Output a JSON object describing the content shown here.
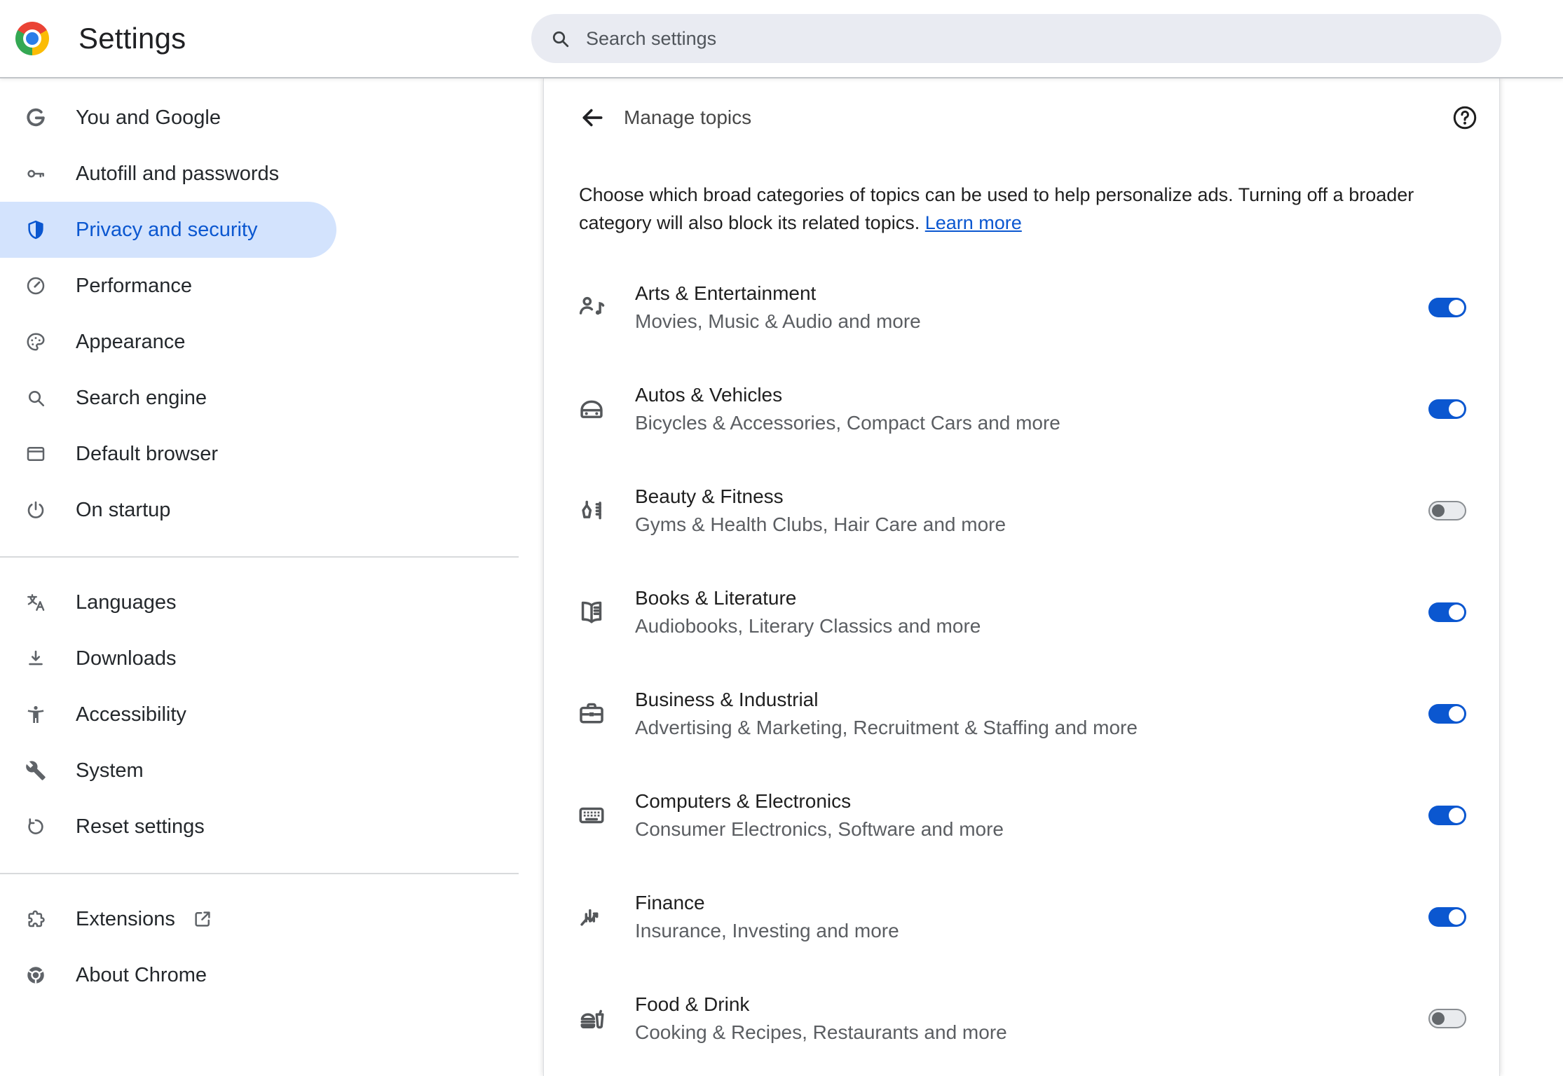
{
  "header": {
    "title": "Settings",
    "logo_icon": "chrome-logo-icon",
    "search_placeholder": "Search settings",
    "search_icon": "search-icon"
  },
  "sidebar": {
    "items": [
      {
        "label": "You and Google",
        "icon": "google-g-icon",
        "selected": false
      },
      {
        "label": "Autofill and passwords",
        "icon": "key-icon",
        "selected": false
      },
      {
        "label": "Privacy and security",
        "icon": "shield-icon",
        "selected": true
      },
      {
        "label": "Performance",
        "icon": "speedometer-icon",
        "selected": false
      },
      {
        "label": "Appearance",
        "icon": "palette-icon",
        "selected": false
      },
      {
        "label": "Search engine",
        "icon": "magnifier-icon",
        "selected": false
      },
      {
        "label": "Default browser",
        "icon": "browser-window-icon",
        "selected": false
      },
      {
        "label": "On startup",
        "icon": "power-icon",
        "selected": false,
        "divider_after": true
      },
      {
        "label": "Languages",
        "icon": "translate-icon",
        "selected": false
      },
      {
        "label": "Downloads",
        "icon": "download-icon",
        "selected": false
      },
      {
        "label": "Accessibility",
        "icon": "accessibility-icon",
        "selected": false
      },
      {
        "label": "System",
        "icon": "wrench-icon",
        "selected": false
      },
      {
        "label": "Reset settings",
        "icon": "reset-icon",
        "selected": false,
        "divider_after": true
      },
      {
        "label": "Extensions",
        "icon": "puzzle-icon",
        "selected": false,
        "external": true,
        "external_icon": "external-link-icon"
      },
      {
        "label": "About Chrome",
        "icon": "chrome-gray-icon",
        "selected": false
      }
    ]
  },
  "main": {
    "back_icon": "back-arrow-icon",
    "title": "Manage topics",
    "help_icon": "help-icon",
    "description": "Choose which broad categories of topics can be used to help personalize ads. Turning off a broader category will also block its related topics.",
    "learn_more_label": "Learn more",
    "topics": [
      {
        "name": "Arts & Entertainment",
        "examples": "Movies, Music & Audio and more",
        "icon": "arts-entertainment-icon",
        "enabled": true
      },
      {
        "name": "Autos & Vehicles",
        "examples": "Bicycles & Accessories, Compact Cars and more",
        "icon": "autos-vehicles-icon",
        "enabled": true
      },
      {
        "name": "Beauty & Fitness",
        "examples": "Gyms & Health Clubs, Hair Care and more",
        "icon": "beauty-fitness-icon",
        "enabled": false
      },
      {
        "name": "Books & Literature",
        "examples": "Audiobooks, Literary Classics and more",
        "icon": "books-literature-icon",
        "enabled": true
      },
      {
        "name": "Business & Industrial",
        "examples": "Advertising & Marketing, Recruitment & Staffing and more",
        "icon": "business-industrial-icon",
        "enabled": true
      },
      {
        "name": "Computers & Electronics",
        "examples": "Consumer Electronics, Software and more",
        "icon": "computers-electronics-icon",
        "enabled": true
      },
      {
        "name": "Finance",
        "examples": "Insurance, Investing and more",
        "icon": "finance-icon",
        "enabled": true
      },
      {
        "name": "Food & Drink",
        "examples": "Cooking & Recipes, Restaurants and more",
        "icon": "food-drink-icon",
        "enabled": false
      }
    ]
  },
  "colors": {
    "accent_blue": "#0b57d0",
    "selected_item_bg": "#d3e3fd",
    "toggle_on": "#0b57d0",
    "toggle_off_track": "#e9ebee",
    "toggle_off_knob": "#64686c",
    "link_blue": "#0b57d0",
    "search_bg": "#e9ebf2",
    "chrome_logo_red": "#ea4335",
    "chrome_logo_yellow": "#fbbc05",
    "chrome_logo_green": "#34a853",
    "chrome_logo_blue": "#2b7de9"
  }
}
